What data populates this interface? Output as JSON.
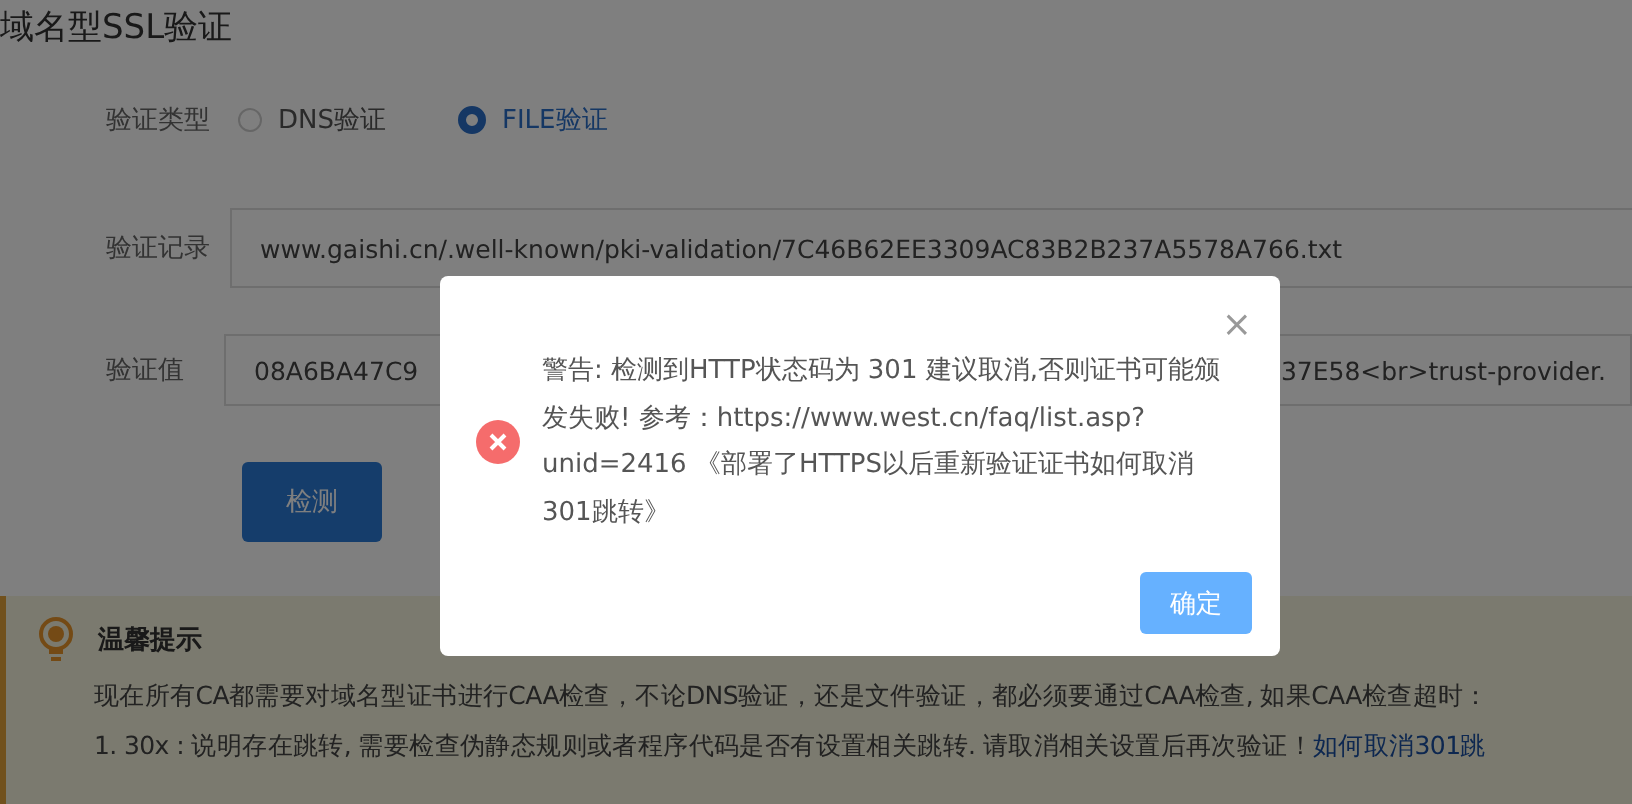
{
  "page_title": "域名型SSL验证",
  "verify_type": {
    "label": "验证类型",
    "options": [
      {
        "label": "DNS验证",
        "selected": false
      },
      {
        "label": "FILE验证",
        "selected": true
      }
    ]
  },
  "record": {
    "label": "验证记录",
    "value": "www.gaishi.cn/.well-known/pki-validation/7C46B62EE3309AC83B2B237A5578A766.txt"
  },
  "value_field": {
    "label": "验证值",
    "value_start": "08A6BA47C9",
    "value_end": "37E58<br>trust-provider."
  },
  "check_button": "检测",
  "tip": {
    "title": "温馨提示",
    "lines": [
      {
        "text": "现在所有CA都需要对域名型证书进行CAA检查，不论DNS验证，还是文件验证，都必须要通过CAA检查, 如果CAA检查超时："
      },
      {
        "text": "1. 30x : 说明存在跳转, 需要检查伪静态规则或者程序代码是否有设置相关跳转. 请取消相关设置后再次验证！",
        "link": "如何取消301跳"
      }
    ]
  },
  "dialog": {
    "close": "×",
    "message": "警告: 检测到HTTP状态码为 301 建议取消,否则证书可能颁发失败! 参考：https://www.west.cn/faq/list.asp?unid=2416 《部署了HTTPS以后重新验证证书如何取消301跳转》",
    "ok_button": "确定"
  }
}
